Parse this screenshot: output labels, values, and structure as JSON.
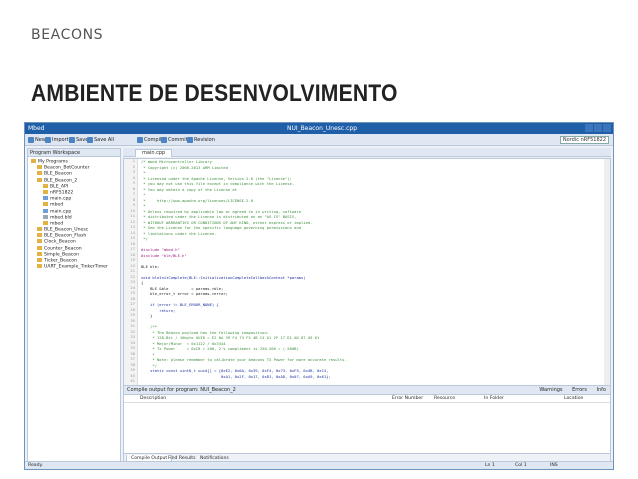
{
  "slide": {
    "kicker": "BEACONS",
    "title": "AMBIENTE DE DESENVOLVIMENTO"
  },
  "ide": {
    "app_name": "Mbed",
    "document_title": "NUI_Beacon_Unesc.cpp",
    "toolbar": [
      {
        "icon": "new-icon",
        "label": "New"
      },
      {
        "icon": "import-icon",
        "label": "Import"
      },
      {
        "icon": "save-icon",
        "label": "Save"
      },
      {
        "icon": "save-all-icon",
        "label": "Save All"
      },
      {
        "icon": "compile-icon",
        "label": "Compile"
      },
      {
        "icon": "commit-icon",
        "label": "Commit"
      },
      {
        "icon": "revision-icon",
        "label": "Revision"
      }
    ],
    "device_label": "Nordic nRF51822",
    "sidebar_header": "Program Workspace",
    "tree": [
      {
        "label": "My Programs",
        "kind": "folder",
        "indent": 0
      },
      {
        "label": "Beacon_BotCounter",
        "kind": "folder",
        "indent": 1
      },
      {
        "label": "BLE_Beacon",
        "kind": "folder",
        "indent": 1
      },
      {
        "label": "BLE_Beacon_2",
        "kind": "folder",
        "indent": 1
      },
      {
        "label": "BLE_API",
        "kind": "folder",
        "indent": 2
      },
      {
        "label": "nRF51822",
        "kind": "folder",
        "indent": 2
      },
      {
        "label": "main.cpp",
        "kind": "file",
        "indent": 2
      },
      {
        "label": "mbed",
        "kind": "folder",
        "indent": 2
      },
      {
        "label": "main.cpp",
        "kind": "file",
        "indent": 2
      },
      {
        "label": "mbed.bld",
        "kind": "doc",
        "indent": 2
      },
      {
        "label": "mbed",
        "kind": "folder",
        "indent": 2
      },
      {
        "label": "BLE_Beacon_Unesc",
        "kind": "folder",
        "indent": 1
      },
      {
        "label": "BLE_Beacon_Flash",
        "kind": "folder",
        "indent": 1
      },
      {
        "label": "Clock_Beacon",
        "kind": "folder",
        "indent": 1
      },
      {
        "label": "Counter_Beacon",
        "kind": "folder",
        "indent": 1
      },
      {
        "label": "Simple_Beacon",
        "kind": "folder",
        "indent": 1
      },
      {
        "label": "Ticker_Beacon",
        "kind": "folder",
        "indent": 1
      },
      {
        "label": "UART_Example_TinkerTimer",
        "kind": "folder",
        "indent": 1
      }
    ],
    "editor_tab": "main.cpp",
    "code_lines": [
      {
        "t": "/* mbed Microcontroller Library",
        "c": "cm"
      },
      {
        "t": " * Copyright (c) 2006-2013 ARM Limited",
        "c": "cm"
      },
      {
        "t": " *",
        "c": "cm"
      },
      {
        "t": " * Licensed under the Apache License, Version 2.0 (the \"License\");",
        "c": "cm"
      },
      {
        "t": " * you may not use this file except in compliance with the License.",
        "c": "cm"
      },
      {
        "t": " * You may obtain a copy of the License at",
        "c": "cm"
      },
      {
        "t": " *",
        "c": "cm"
      },
      {
        "t": " *     http://www.apache.org/licenses/LICENSE-2.0",
        "c": "cm"
      },
      {
        "t": " *",
        "c": "cm"
      },
      {
        "t": " * Unless required by applicable law or agreed to in writing, software",
        "c": "cm"
      },
      {
        "t": " * distributed under the License is distributed on an \"AS IS\" BASIS,",
        "c": "cm"
      },
      {
        "t": " * WITHOUT WARRANTIES OR CONDITIONS OF ANY KIND, either express or implied.",
        "c": "cm"
      },
      {
        "t": " * See the License for the specific language governing permissions and",
        "c": "cm"
      },
      {
        "t": " * limitations under the License.",
        "c": "cm"
      },
      {
        "t": " */",
        "c": "cm"
      },
      {
        "t": "",
        "c": "tx"
      },
      {
        "t": "#include \"mbed.h\"",
        "c": "pp"
      },
      {
        "t": "#include \"ble/BLE.h\"",
        "c": "pp"
      },
      {
        "t": "",
        "c": "tx"
      },
      {
        "t": "BLE ble;",
        "c": "tx"
      },
      {
        "t": "",
        "c": "tx"
      },
      {
        "t": "void bleInitComplete(BLE::InitializationCompleteCallbackContext *params)",
        "c": "kw"
      },
      {
        "t": "{",
        "c": "tx"
      },
      {
        "t": "    BLE &ble          = params->ble;",
        "c": "tx"
      },
      {
        "t": "    ble_error_t error = params->error;",
        "c": "tx"
      },
      {
        "t": "",
        "c": "tx"
      },
      {
        "t": "    if (error != BLE_ERROR_NONE) {",
        "c": "kw"
      },
      {
        "t": "        return;",
        "c": "kw"
      },
      {
        "t": "    }",
        "c": "tx"
      },
      {
        "t": "",
        "c": "tx"
      },
      {
        "t": "    /**",
        "c": "cm"
      },
      {
        "t": "     * The Beacon payload has the following composition:",
        "c": "cm"
      },
      {
        "t": "     * 128-Bit / 16byte UUID = E2 0A 39 F4 73 F5 4B C4 A1 2F 17 D1 AD 07 A9 61",
        "c": "cm"
      },
      {
        "t": "     * Major/Minor  = 0x1122 / 0x3344",
        "c": "cm"
      },
      {
        "t": "     * Tx Power     = 0xC8 = 200, 2's compliment is 256-200 = (-56dB)",
        "c": "cm"
      },
      {
        "t": "     *",
        "c": "cm"
      },
      {
        "t": "     * Note: please remember to calibrate your beacons TX Power for more accurate results.",
        "c": "cm"
      },
      {
        "t": "     */",
        "c": "cm"
      },
      {
        "t": "    static const uint8_t uuid[] = {0xE2, 0x0A, 0x39, 0xF4, 0x73, 0xF5, 0x4B, 0xC4,",
        "c": "kw"
      },
      {
        "t": "                                   0xA1, 0x2F, 0x17, 0xD1, 0xAD, 0x07, 0xA9, 0x61};",
        "c": "kw"
      },
      {
        "t": "",
        "c": "tx"
      }
    ],
    "output": {
      "header": "Compile output for program: NUI_Beacon_2",
      "options": [
        "Warnings",
        "Errors",
        "Info"
      ],
      "columns": [
        "Description",
        "Error Number",
        "Resource",
        "In Folder",
        "Location"
      ],
      "tabs": [
        "Compile Output",
        "Find Results",
        "Notifications"
      ]
    },
    "status": {
      "left": "Ready.",
      "ln": "Ln 1",
      "col": "Col 1",
      "mode": "INS"
    }
  }
}
